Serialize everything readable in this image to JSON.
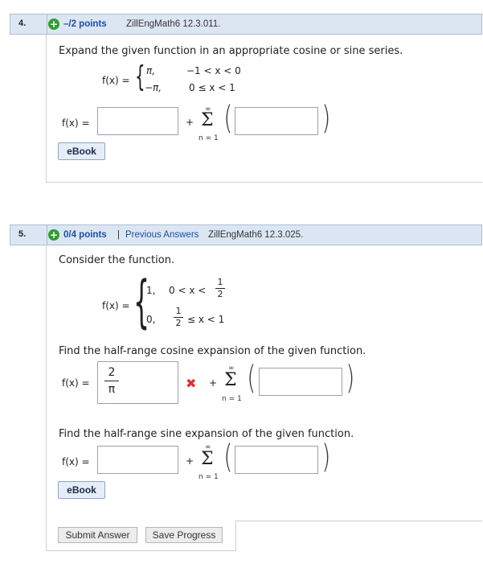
{
  "q4": {
    "number": "4.",
    "points": "–/2 points",
    "source": "ZillEngMath6 12.3.011.",
    "prompt": "Expand the given function in an appropriate cosine or sine series.",
    "fx_label": "f(x) =",
    "case1_value": "π,",
    "case1_cond": "−1 < x < 0",
    "case2_value": "−π,",
    "case2_cond": "0 ≤ x < 1",
    "answer_label": "f(x) =",
    "plus": "+",
    "sigma": "Σ",
    "sum_upper": "∞",
    "sum_lower": "n = 1",
    "answer_value": "",
    "series_value": "",
    "ebook_label": "eBook"
  },
  "q5": {
    "number": "5.",
    "points": "0/4 points",
    "separator": "|",
    "previous_answers": "Previous Answers",
    "source": "ZillEngMath6 12.3.025.",
    "prompt": "Consider the function.",
    "fx_label": "f(x) =",
    "case1_value": "1,",
    "case1_cond_prefix": "0 < x <",
    "case1_cond_frac_num": "1",
    "case1_cond_frac_den": "2",
    "case2_value": "0,",
    "case2_cond_frac_num": "1",
    "case2_cond_frac_den": "2",
    "case2_cond_suffix": "≤ x < 1",
    "cosine_prompt": "Find the half-range cosine expansion of the given function.",
    "cosine_label": "f(x) =",
    "cosine_answer_num": "2",
    "cosine_answer_den": "π",
    "cosine_status": "✖",
    "sine_prompt": "Find the half-range sine expansion of the given function.",
    "sine_label": "f(x) =",
    "plus": "+",
    "sigma": "Σ",
    "sum_upper": "∞",
    "sum_lower": "n = 1",
    "ebook_label": "eBook",
    "submit_label": "Submit Answer",
    "save_label": "Save Progress"
  },
  "colors": {
    "header_bg": "#dce6f2",
    "link_blue": "#1b4fa8",
    "plus_green": "#2e9e2e",
    "error_red": "#d9323a"
  }
}
